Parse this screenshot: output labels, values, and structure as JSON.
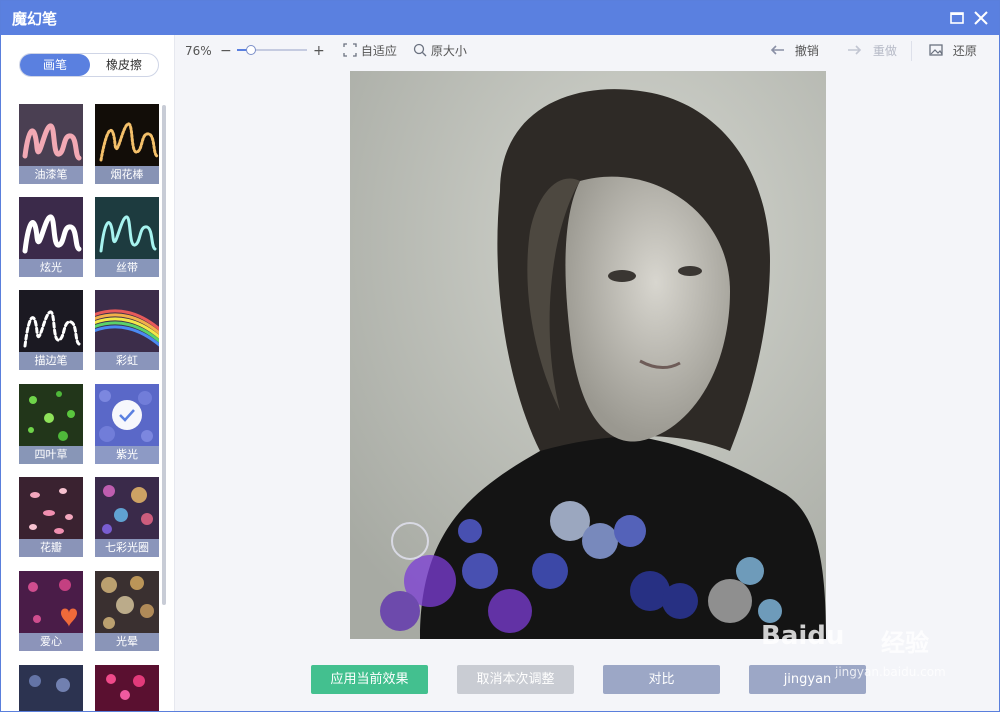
{
  "window": {
    "title": "魔幻笔"
  },
  "tool_tabs": [
    {
      "label": "画笔",
      "active": true
    },
    {
      "label": "橡皮擦",
      "active": false
    }
  ],
  "brushes": [
    {
      "label": "油漆笔",
      "selected": false
    },
    {
      "label": "烟花棒",
      "selected": false
    },
    {
      "label": "炫光",
      "selected": false
    },
    {
      "label": "丝带",
      "selected": false
    },
    {
      "label": "描边笔",
      "selected": false
    },
    {
      "label": "彩虹",
      "selected": false
    },
    {
      "label": "四叶草",
      "selected": false
    },
    {
      "label": "紫光",
      "selected": true
    },
    {
      "label": "花瓣",
      "selected": false
    },
    {
      "label": "七彩光圈",
      "selected": false
    },
    {
      "label": "爱心",
      "selected": false
    },
    {
      "label": "光晕",
      "selected": false
    }
  ],
  "toolbar": {
    "zoom": "76%",
    "zoom_fraction": 0.2,
    "fit_label": "自适应",
    "actual_size_label": "原大小",
    "undo_label": "撤销",
    "redo_label": "重做",
    "restore_label": "还原"
  },
  "actions": {
    "apply": "应用当前效果",
    "cancel": "取消本次调整",
    "compare": "对比",
    "save": "jingyan"
  },
  "watermark": {
    "brand": "Baidu",
    "product": "经验",
    "url": "jingyan.baidu.com"
  },
  "colors": {
    "accent": "#5a80e0",
    "apply": "#43c08f",
    "neutral": "#9ca7c6"
  }
}
